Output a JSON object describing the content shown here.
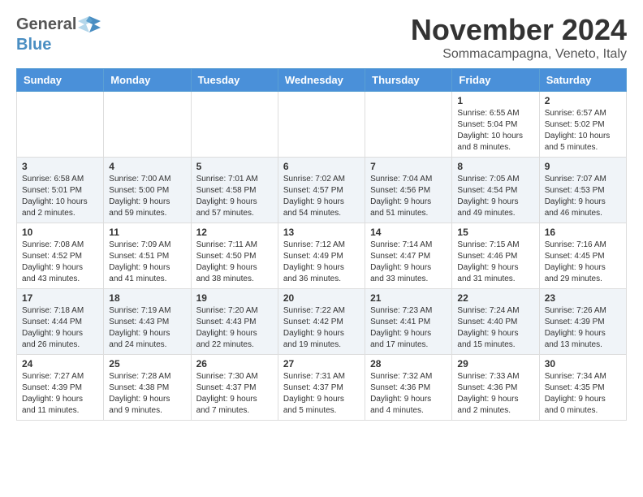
{
  "header": {
    "logo_general": "General",
    "logo_blue": "Blue",
    "title": "November 2024",
    "subtitle": "Sommacampagna, Veneto, Italy"
  },
  "days_of_week": [
    "Sunday",
    "Monday",
    "Tuesday",
    "Wednesday",
    "Thursday",
    "Friday",
    "Saturday"
  ],
  "weeks": [
    [
      {
        "day": "",
        "info": ""
      },
      {
        "day": "",
        "info": ""
      },
      {
        "day": "",
        "info": ""
      },
      {
        "day": "",
        "info": ""
      },
      {
        "day": "",
        "info": ""
      },
      {
        "day": "1",
        "info": "Sunrise: 6:55 AM\nSunset: 5:04 PM\nDaylight: 10 hours and 8 minutes."
      },
      {
        "day": "2",
        "info": "Sunrise: 6:57 AM\nSunset: 5:02 PM\nDaylight: 10 hours and 5 minutes."
      }
    ],
    [
      {
        "day": "3",
        "info": "Sunrise: 6:58 AM\nSunset: 5:01 PM\nDaylight: 10 hours and 2 minutes."
      },
      {
        "day": "4",
        "info": "Sunrise: 7:00 AM\nSunset: 5:00 PM\nDaylight: 9 hours and 59 minutes."
      },
      {
        "day": "5",
        "info": "Sunrise: 7:01 AM\nSunset: 4:58 PM\nDaylight: 9 hours and 57 minutes."
      },
      {
        "day": "6",
        "info": "Sunrise: 7:02 AM\nSunset: 4:57 PM\nDaylight: 9 hours and 54 minutes."
      },
      {
        "day": "7",
        "info": "Sunrise: 7:04 AM\nSunset: 4:56 PM\nDaylight: 9 hours and 51 minutes."
      },
      {
        "day": "8",
        "info": "Sunrise: 7:05 AM\nSunset: 4:54 PM\nDaylight: 9 hours and 49 minutes."
      },
      {
        "day": "9",
        "info": "Sunrise: 7:07 AM\nSunset: 4:53 PM\nDaylight: 9 hours and 46 minutes."
      }
    ],
    [
      {
        "day": "10",
        "info": "Sunrise: 7:08 AM\nSunset: 4:52 PM\nDaylight: 9 hours and 43 minutes."
      },
      {
        "day": "11",
        "info": "Sunrise: 7:09 AM\nSunset: 4:51 PM\nDaylight: 9 hours and 41 minutes."
      },
      {
        "day": "12",
        "info": "Sunrise: 7:11 AM\nSunset: 4:50 PM\nDaylight: 9 hours and 38 minutes."
      },
      {
        "day": "13",
        "info": "Sunrise: 7:12 AM\nSunset: 4:49 PM\nDaylight: 9 hours and 36 minutes."
      },
      {
        "day": "14",
        "info": "Sunrise: 7:14 AM\nSunset: 4:47 PM\nDaylight: 9 hours and 33 minutes."
      },
      {
        "day": "15",
        "info": "Sunrise: 7:15 AM\nSunset: 4:46 PM\nDaylight: 9 hours and 31 minutes."
      },
      {
        "day": "16",
        "info": "Sunrise: 7:16 AM\nSunset: 4:45 PM\nDaylight: 9 hours and 29 minutes."
      }
    ],
    [
      {
        "day": "17",
        "info": "Sunrise: 7:18 AM\nSunset: 4:44 PM\nDaylight: 9 hours and 26 minutes."
      },
      {
        "day": "18",
        "info": "Sunrise: 7:19 AM\nSunset: 4:43 PM\nDaylight: 9 hours and 24 minutes."
      },
      {
        "day": "19",
        "info": "Sunrise: 7:20 AM\nSunset: 4:43 PM\nDaylight: 9 hours and 22 minutes."
      },
      {
        "day": "20",
        "info": "Sunrise: 7:22 AM\nSunset: 4:42 PM\nDaylight: 9 hours and 19 minutes."
      },
      {
        "day": "21",
        "info": "Sunrise: 7:23 AM\nSunset: 4:41 PM\nDaylight: 9 hours and 17 minutes."
      },
      {
        "day": "22",
        "info": "Sunrise: 7:24 AM\nSunset: 4:40 PM\nDaylight: 9 hours and 15 minutes."
      },
      {
        "day": "23",
        "info": "Sunrise: 7:26 AM\nSunset: 4:39 PM\nDaylight: 9 hours and 13 minutes."
      }
    ],
    [
      {
        "day": "24",
        "info": "Sunrise: 7:27 AM\nSunset: 4:39 PM\nDaylight: 9 hours and 11 minutes."
      },
      {
        "day": "25",
        "info": "Sunrise: 7:28 AM\nSunset: 4:38 PM\nDaylight: 9 hours and 9 minutes."
      },
      {
        "day": "26",
        "info": "Sunrise: 7:30 AM\nSunset: 4:37 PM\nDaylight: 9 hours and 7 minutes."
      },
      {
        "day": "27",
        "info": "Sunrise: 7:31 AM\nSunset: 4:37 PM\nDaylight: 9 hours and 5 minutes."
      },
      {
        "day": "28",
        "info": "Sunrise: 7:32 AM\nSunset: 4:36 PM\nDaylight: 9 hours and 4 minutes."
      },
      {
        "day": "29",
        "info": "Sunrise: 7:33 AM\nSunset: 4:36 PM\nDaylight: 9 hours and 2 minutes."
      },
      {
        "day": "30",
        "info": "Sunrise: 7:34 AM\nSunset: 4:35 PM\nDaylight: 9 hours and 0 minutes."
      }
    ]
  ]
}
